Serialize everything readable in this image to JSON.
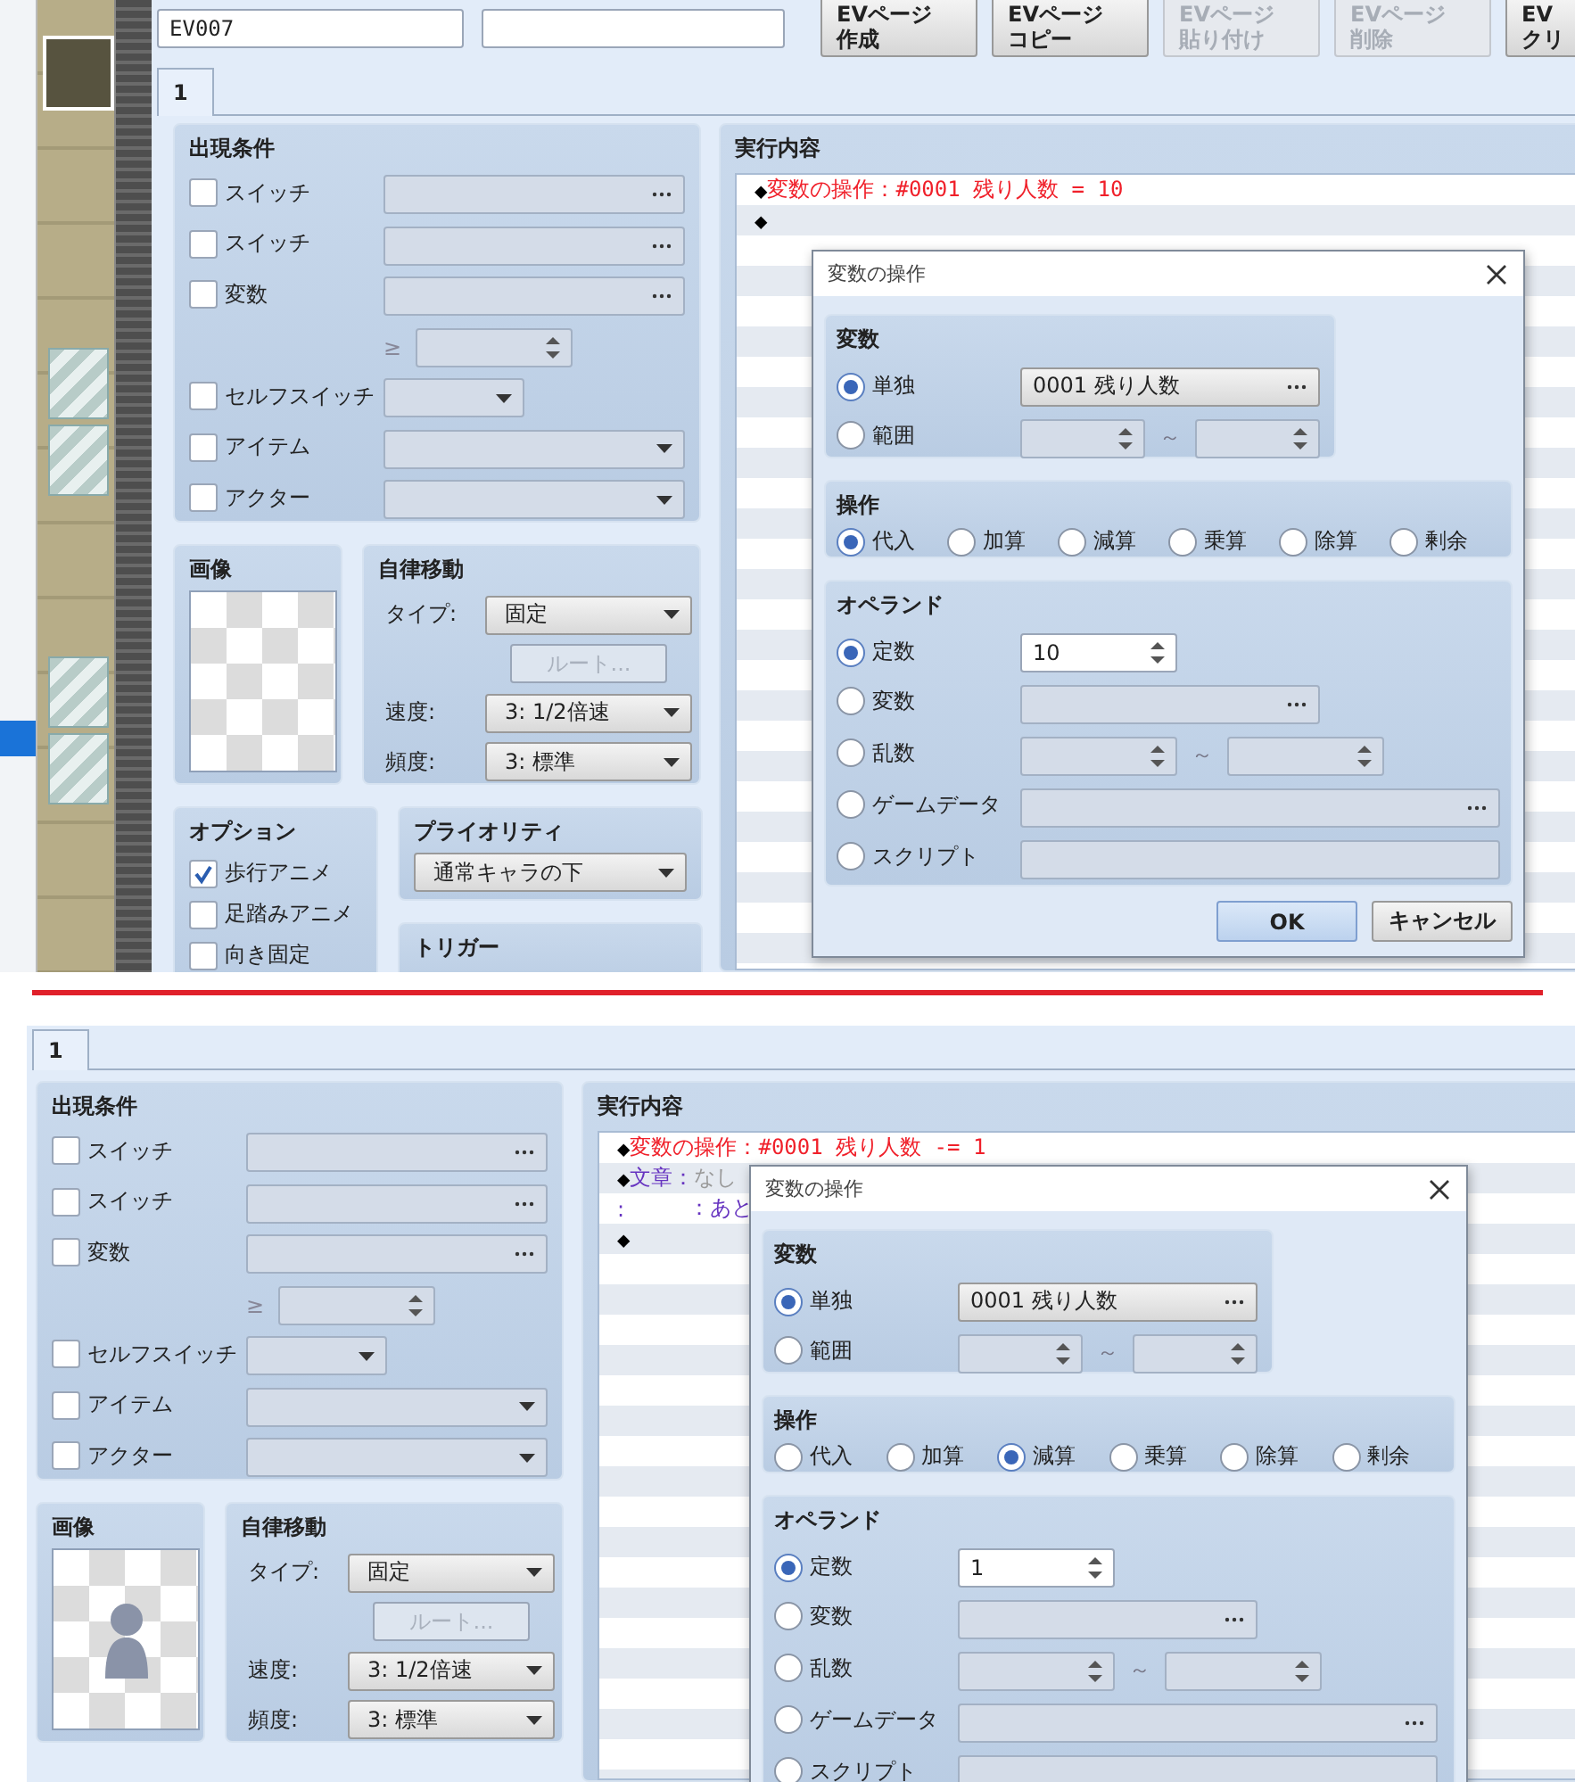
{
  "shots": [
    {
      "kind": "full",
      "header": {
        "name_value": "EV007",
        "buttons": [
          {
            "lines": [
              "EVページ",
              "作成"
            ],
            "disabled": false
          },
          {
            "lines": [
              "EVページ",
              "コピー"
            ],
            "disabled": false
          },
          {
            "lines": [
              "EVページ",
              "貼り付け"
            ],
            "disabled": true
          },
          {
            "lines": [
              "EVページ",
              "削除"
            ],
            "disabled": true
          },
          {
            "lines": [
              "EV",
              "クリ"
            ],
            "disabled": false
          }
        ]
      },
      "tabs": [
        {
          "label": "1",
          "selected": true
        }
      ],
      "conditions": {
        "title": "出現条件",
        "rows": [
          {
            "kind": "picker",
            "label": "スイッチ",
            "checked": false
          },
          {
            "kind": "picker",
            "label": "スイッチ",
            "checked": false
          },
          {
            "kind": "picker",
            "label": "変数",
            "checked": false
          },
          {
            "kind": "spin",
            "prefix": "≥"
          },
          {
            "kind": "combo_small",
            "label": "セルフスイッチ",
            "checked": false
          },
          {
            "kind": "combo",
            "label": "アイテム",
            "checked": false
          },
          {
            "kind": "combo",
            "label": "アクター",
            "checked": false
          }
        ]
      },
      "image": {
        "title": "画像",
        "sprite": false
      },
      "movement": {
        "title": "自律移動",
        "rows": [
          {
            "kind": "combo",
            "label": "タイプ:",
            "value": "固定"
          },
          {
            "kind": "button",
            "label": "ルート...",
            "disabled": true
          },
          {
            "kind": "combo",
            "label": "速度:",
            "value": "3: 1/2倍速"
          },
          {
            "kind": "combo",
            "label": "頻度:",
            "value": "3: 標準"
          }
        ]
      },
      "options": {
        "title": "オプション",
        "items": [
          {
            "label": "歩行アニメ",
            "checked": true
          },
          {
            "label": "足踏みアニメ",
            "checked": false
          },
          {
            "label": "向き固定",
            "checked": false
          }
        ]
      },
      "priority": {
        "title": "プライオリティ",
        "value": "通常キャラの下"
      },
      "trigger": {
        "title": "トリガー"
      },
      "contents": {
        "title": "実行内容",
        "lines": [
          {
            "parts": [
              {
                "kind": "marker",
                "text": "◆"
              },
              {
                "kind": "command",
                "text": "変数の操作：#0001 残り人数 = 10"
              }
            ]
          },
          {
            "parts": [
              {
                "kind": "marker",
                "text": "◆"
              }
            ]
          }
        ]
      },
      "dialog": {
        "title": "変数の操作",
        "variable": {
          "title": "変数",
          "options": [
            {
              "kind": "picker",
              "label": "単独",
              "selected": true,
              "value": "0001 残り人数"
            },
            {
              "kind": "range",
              "label": "範囲",
              "selected": false,
              "separator": "～"
            }
          ]
        },
        "operation": {
          "title": "操作",
          "options": [
            {
              "label": "代入",
              "selected": true
            },
            {
              "label": "加算",
              "selected": false
            },
            {
              "label": "減算",
              "selected": false
            },
            {
              "label": "乗算",
              "selected": false
            },
            {
              "label": "除算",
              "selected": false
            },
            {
              "label": "剰余",
              "selected": false
            }
          ]
        },
        "operand": {
          "title": "オペランド",
          "options": [
            {
              "kind": "spin",
              "label": "定数",
              "selected": true,
              "value": "10"
            },
            {
              "kind": "picker",
              "label": "変数",
              "selected": false
            },
            {
              "kind": "range",
              "label": "乱数",
              "selected": false,
              "separator": "～"
            },
            {
              "kind": "wide_picker",
              "label": "ゲームデータ",
              "selected": false
            },
            {
              "kind": "text",
              "label": "スクリプト",
              "selected": false
            }
          ]
        },
        "buttons": [
          {
            "kind": "default",
            "label": "OK"
          },
          {
            "kind": "normal",
            "label": "キャンセル"
          }
        ]
      }
    },
    {
      "kind": "cropped",
      "tabs": [
        {
          "label": "1",
          "selected": true
        }
      ],
      "conditions": {
        "title": "出現条件",
        "rows": [
          {
            "kind": "picker",
            "label": "スイッチ",
            "checked": false
          },
          {
            "kind": "picker",
            "label": "スイッチ",
            "checked": false
          },
          {
            "kind": "picker",
            "label": "変数",
            "checked": false
          },
          {
            "kind": "spin",
            "prefix": "≥"
          },
          {
            "kind": "combo_small",
            "label": "セルフスイッチ",
            "checked": false
          },
          {
            "kind": "combo",
            "label": "アイテム",
            "checked": false
          },
          {
            "kind": "combo",
            "label": "アクター",
            "checked": false
          }
        ]
      },
      "image": {
        "title": "画像",
        "sprite": true
      },
      "movement": {
        "title": "自律移動",
        "rows": [
          {
            "kind": "combo",
            "label": "タイプ:",
            "value": "固定"
          },
          {
            "kind": "button",
            "label": "ルート...",
            "disabled": true
          },
          {
            "kind": "combo",
            "label": "速度:",
            "value": "3: 1/2倍速"
          },
          {
            "kind": "combo",
            "label": "頻度:",
            "value": "3: 標準"
          }
        ]
      },
      "contents": {
        "title": "実行内容",
        "lines": [
          {
            "parts": [
              {
                "kind": "marker",
                "text": "◆"
              },
              {
                "kind": "command",
                "text": "変数の操作：#0001 残り人数 -= 1"
              }
            ]
          },
          {
            "parts": [
              {
                "kind": "marker",
                "text": "◆"
              },
              {
                "kind": "message",
                "text": "文章："
              },
              {
                "kind": "muted",
                "text": "なし"
              }
            ]
          },
          {
            "parts": [
              {
                "kind": "message",
                "text": ":"
              },
              {
                "kind": "message",
                "text": "：あと"
              }
            ]
          },
          {
            "parts": [
              {
                "kind": "marker",
                "text": "◆"
              }
            ]
          }
        ]
      },
      "dialog": {
        "title": "変数の操作",
        "variable": {
          "title": "変数",
          "options": [
            {
              "kind": "picker",
              "label": "単独",
              "selected": true,
              "value": "0001 残り人数"
            },
            {
              "kind": "range",
              "label": "範囲",
              "selected": false,
              "separator": "～"
            }
          ]
        },
        "operation": {
          "title": "操作",
          "options": [
            {
              "label": "代入",
              "selected": false
            },
            {
              "label": "加算",
              "selected": false
            },
            {
              "label": "減算",
              "selected": true
            },
            {
              "label": "乗算",
              "selected": false
            },
            {
              "label": "除算",
              "selected": false
            },
            {
              "label": "剰余",
              "selected": false
            }
          ]
        },
        "operand": {
          "title": "オペランド",
          "options": [
            {
              "kind": "spin",
              "label": "定数",
              "selected": true,
              "value": "1"
            },
            {
              "kind": "picker",
              "label": "変数",
              "selected": false
            },
            {
              "kind": "range",
              "label": "乱数",
              "selected": false,
              "separator": "～"
            },
            {
              "kind": "wide_picker",
              "label": "ゲームデータ",
              "selected": false
            },
            {
              "kind": "text",
              "label": "スクリプト",
              "selected": false
            }
          ]
        }
      }
    }
  ]
}
